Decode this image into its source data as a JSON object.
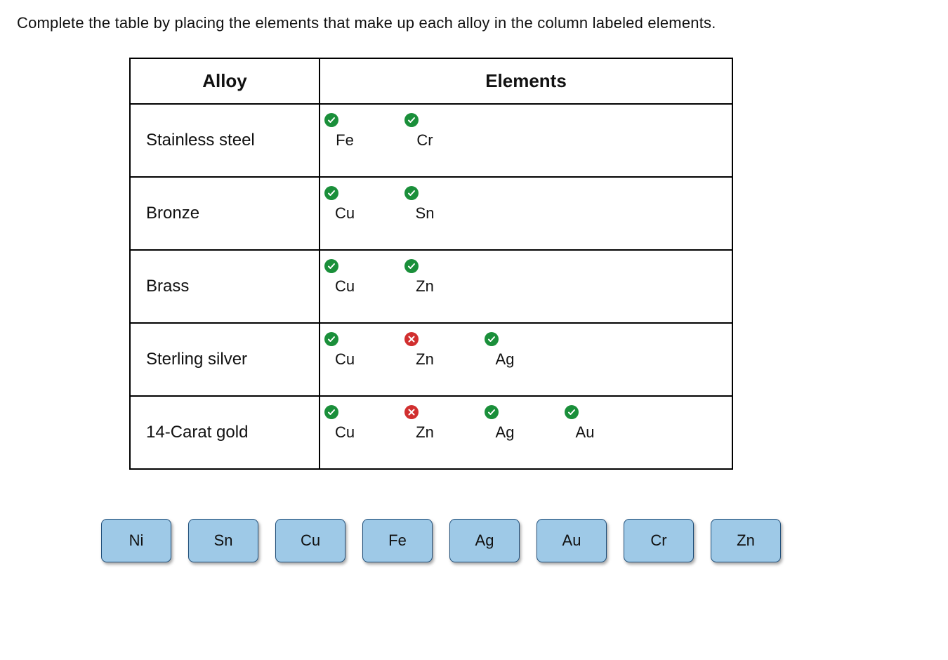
{
  "prompt": "Complete the table by placing the elements that make up each alloy in the column labeled elements.",
  "headers": {
    "alloy": "Alloy",
    "elements": "Elements"
  },
  "rows": [
    {
      "name": "Stainless steel",
      "placed": [
        {
          "sym": "Fe",
          "status": "correct"
        },
        {
          "sym": "Cr",
          "status": "correct"
        }
      ]
    },
    {
      "name": "Bronze",
      "placed": [
        {
          "sym": "Cu",
          "status": "correct"
        },
        {
          "sym": "Sn",
          "status": "correct"
        }
      ]
    },
    {
      "name": "Brass",
      "placed": [
        {
          "sym": "Cu",
          "status": "correct"
        },
        {
          "sym": "Zn",
          "status": "correct"
        }
      ]
    },
    {
      "name": "Sterling silver",
      "placed": [
        {
          "sym": "Cu",
          "status": "correct"
        },
        {
          "sym": "Zn",
          "status": "wrong"
        },
        {
          "sym": "Ag",
          "status": "correct"
        }
      ]
    },
    {
      "name": "14-Carat gold",
      "placed": [
        {
          "sym": "Cu",
          "status": "correct"
        },
        {
          "sym": "Zn",
          "status": "wrong"
        },
        {
          "sym": "Ag",
          "status": "correct"
        },
        {
          "sym": "Au",
          "status": "correct"
        }
      ]
    }
  ],
  "choices": [
    "Ni",
    "Sn",
    "Cu",
    "Fe",
    "Ag",
    "Au",
    "Cr",
    "Zn"
  ]
}
